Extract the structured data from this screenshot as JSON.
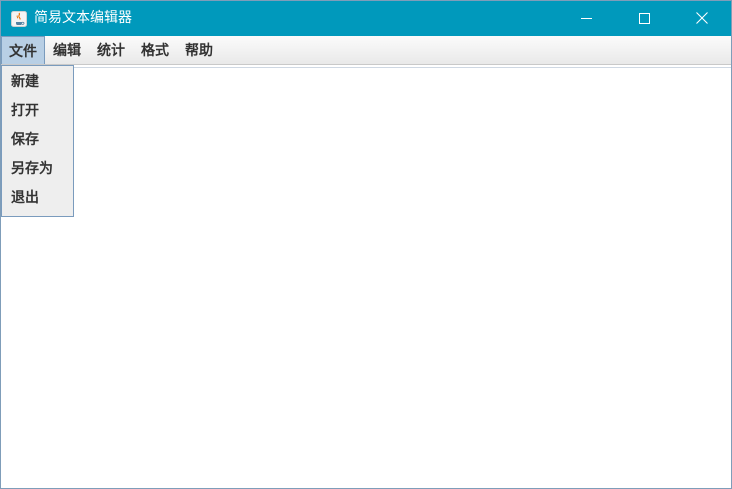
{
  "window": {
    "title": "简易文本编辑器",
    "title_bar_color": "#0099bc"
  },
  "title_controls": {
    "minimize_icon": "minimize-icon",
    "maximize_icon": "maximize-icon",
    "close_icon": "close-icon"
  },
  "menubar": {
    "items": [
      {
        "label": "文件",
        "active": true
      },
      {
        "label": "编辑"
      },
      {
        "label": "统计"
      },
      {
        "label": "格式"
      },
      {
        "label": "帮助"
      }
    ]
  },
  "file_menu": {
    "items": [
      {
        "label": "新建"
      },
      {
        "label": "打开"
      },
      {
        "label": "保存"
      },
      {
        "label": "另存为"
      },
      {
        "label": "退出"
      }
    ]
  },
  "editor": {
    "content": ""
  }
}
